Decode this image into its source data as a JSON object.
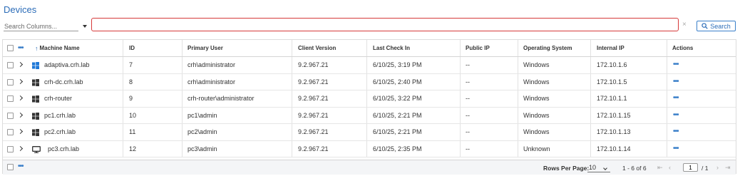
{
  "page": {
    "title": "Devices"
  },
  "toolbar": {
    "search_columns_placeholder": "Search Columns...",
    "search_value": "",
    "clear_symbol": "×",
    "search_button_label": "Search"
  },
  "grid": {
    "columns": [
      "Machine Name",
      "ID",
      "Primary User",
      "Client Version",
      "Last Check In",
      "Public IP",
      "Operating System",
      "Internal IP",
      "Actions"
    ],
    "sorted_column": "Machine Name",
    "sort_direction": "ascending",
    "header_menu": "•••",
    "rows": [
      {
        "os_icon": "windows-blue-icon",
        "machine": "adaptiva.crh.lab",
        "id": "7",
        "user": "crh\\administrator",
        "client": "9.2.967.21",
        "checkin": "6/10/25, 3:19 PM",
        "public_ip": "--",
        "os": "Windows",
        "internal_ip": "172.10.1.6",
        "actions": "•••"
      },
      {
        "os_icon": "windows-icon",
        "machine": "crh-dc.crh.lab",
        "id": "8",
        "user": "crh\\administrator",
        "client": "9.2.967.21",
        "checkin": "6/10/25, 2:40 PM",
        "public_ip": "--",
        "os": "Windows",
        "internal_ip": "172.10.1.5",
        "actions": "•••"
      },
      {
        "os_icon": "windows-icon",
        "machine": "crh-router",
        "id": "9",
        "user": "crh-router\\administrator",
        "client": "9.2.967.21",
        "checkin": "6/10/25, 3:22 PM",
        "public_ip": "--",
        "os": "Windows",
        "internal_ip": "172.10.1.1",
        "actions": "•••"
      },
      {
        "os_icon": "windows-icon",
        "machine": "pc1.crh.lab",
        "id": "10",
        "user": "pc1\\admin",
        "client": "9.2.967.21",
        "checkin": "6/10/25, 2:21 PM",
        "public_ip": "--",
        "os": "Windows",
        "internal_ip": "172.10.1.15",
        "actions": "•••"
      },
      {
        "os_icon": "windows-icon",
        "machine": "pc2.crh.lab",
        "id": "11",
        "user": "pc2\\admin",
        "client": "9.2.967.21",
        "checkin": "6/10/25, 2:21 PM",
        "public_ip": "--",
        "os": "Windows",
        "internal_ip": "172.10.1.13",
        "actions": "•••"
      },
      {
        "os_icon": "monitor-icon",
        "machine": "pc3.crh.lab",
        "id": "12",
        "user": "pc3\\admin",
        "client": "9.2.967.21",
        "checkin": "6/10/25, 2:35 PM",
        "public_ip": "--",
        "os": "Unknown",
        "internal_ip": "172.10.1.14",
        "actions": "•••"
      }
    ]
  },
  "footer": {
    "menu": "•••",
    "rows_per_page_label": "Rows Per Page:",
    "rows_per_page_value": "10",
    "range_text": "1 - 6 of 6",
    "current_page": "1",
    "total_pages": "/ 1"
  },
  "colors": {
    "accent": "#2b6cb8",
    "search_border": "#d63a3a",
    "windows_blue": "#1e78d7"
  }
}
